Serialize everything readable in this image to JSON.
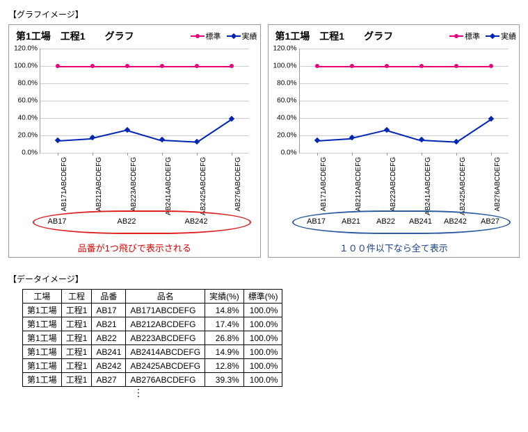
{
  "labels": {
    "graph_section": "【グラフイメージ】",
    "data_section": "【データイメージ】",
    "vdots": "⋮"
  },
  "legend": {
    "std": "標準",
    "act": "実績"
  },
  "chart_common": {
    "title": "第1工場　工程1　　グラフ",
    "y_ticks": [
      "0.0%",
      "20.0%",
      "40.0%",
      "60.0%",
      "80.0%",
      "100.0%",
      "120.0%"
    ],
    "x_labels": [
      "AB171ABCDEFG",
      "AB212ABCDEFG",
      "AB223ABCDEFG",
      "AB2414ABCDEFG",
      "AB2425ABCDEFG",
      "AB276ABCDEFG"
    ]
  },
  "chart_left": {
    "group_labels": [
      "AB17",
      "AB22",
      "AB242"
    ],
    "caption": "品番が1つ飛びで表示される"
  },
  "chart_right": {
    "group_labels": [
      "AB17",
      "AB21",
      "AB22",
      "AB241",
      "AB242",
      "AB27"
    ],
    "caption": "１００件以下なら全て表示"
  },
  "chart_data": [
    {
      "type": "line",
      "title": "第1工場 工程1 グラフ",
      "categories": [
        "AB171ABCDEFG",
        "AB212ABCDEFG",
        "AB223ABCDEFG",
        "AB2414ABCDEFG",
        "AB2425ABCDEFG",
        "AB276ABCDEFG"
      ],
      "series": [
        {
          "name": "標準",
          "values": [
            100.0,
            100.0,
            100.0,
            100.0,
            100.0,
            100.0
          ]
        },
        {
          "name": "実績",
          "values": [
            14.8,
            17.4,
            26.8,
            14.9,
            12.8,
            39.3
          ]
        }
      ],
      "ylabel": "%",
      "ylim": [
        0,
        120
      ],
      "note": "品番が1つ飛びで表示される",
      "group_axis": [
        "AB17",
        "",
        "AB22",
        "",
        "AB242",
        ""
      ]
    },
    {
      "type": "line",
      "title": "第1工場 工程1 グラフ",
      "categories": [
        "AB171ABCDEFG",
        "AB212ABCDEFG",
        "AB223ABCDEFG",
        "AB2414ABCDEFG",
        "AB2425ABCDEFG",
        "AB276ABCDEFG"
      ],
      "series": [
        {
          "name": "標準",
          "values": [
            100.0,
            100.0,
            100.0,
            100.0,
            100.0,
            100.0
          ]
        },
        {
          "name": "実績",
          "values": [
            14.8,
            17.4,
            26.8,
            14.9,
            12.8,
            39.3
          ]
        }
      ],
      "ylabel": "%",
      "ylim": [
        0,
        120
      ],
      "note": "１００件以下なら全て表示",
      "group_axis": [
        "AB17",
        "AB21",
        "AB22",
        "AB241",
        "AB242",
        "AB27"
      ]
    }
  ],
  "table": {
    "headers": [
      "工場",
      "工程",
      "品番",
      "品名",
      "実績(%)",
      "標準(%)"
    ],
    "rows": [
      [
        "第1工場",
        "工程1",
        "AB17",
        "AB171ABCDEFG",
        "14.8%",
        "100.0%"
      ],
      [
        "第1工場",
        "工程1",
        "AB21",
        "AB212ABCDEFG",
        "17.4%",
        "100.0%"
      ],
      [
        "第1工場",
        "工程1",
        "AB22",
        "AB223ABCDEFG",
        "26.8%",
        "100.0%"
      ],
      [
        "第1工場",
        "工程1",
        "AB241",
        "AB2414ABCDEFG",
        "14.9%",
        "100.0%"
      ],
      [
        "第1工場",
        "工程1",
        "AB242",
        "AB2425ABCDEFG",
        "12.8%",
        "100.0%"
      ],
      [
        "第1工場",
        "工程1",
        "AB27",
        "AB276ABCDEFG",
        "39.3%",
        "100.0%"
      ]
    ]
  }
}
